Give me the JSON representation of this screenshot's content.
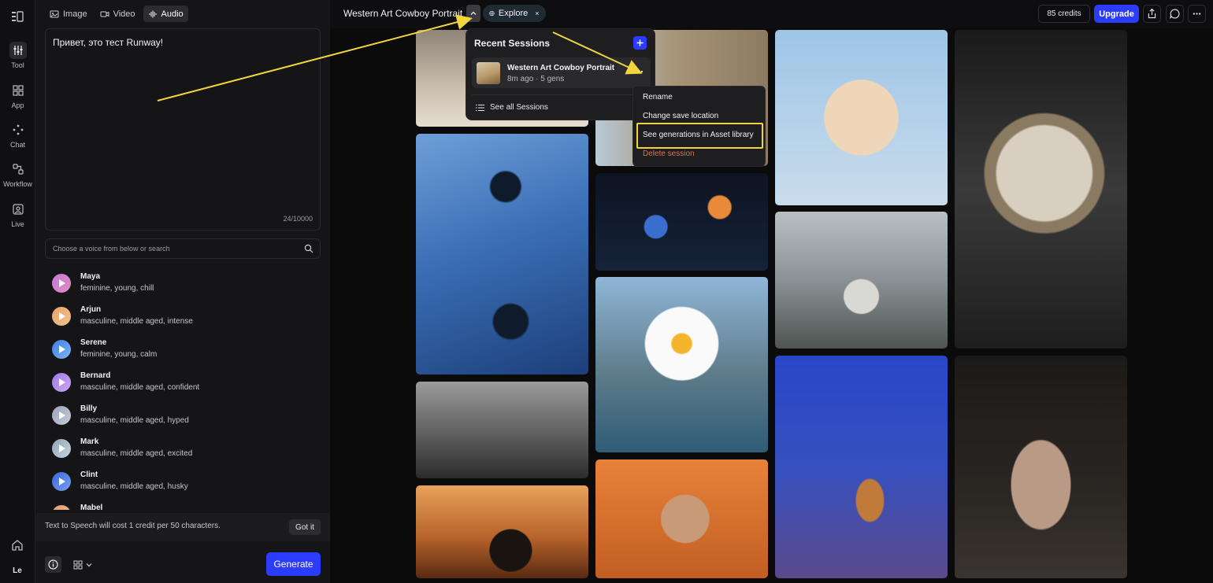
{
  "rail": {
    "items": [
      {
        "label": "Tool",
        "icon": "sliders-icon"
      },
      {
        "label": "App",
        "icon": "grid-icon"
      },
      {
        "label": "Chat",
        "icon": "sparkle-icon"
      },
      {
        "label": "Workflow",
        "icon": "workflow-icon"
      },
      {
        "label": "Live",
        "icon": "live-icon"
      }
    ],
    "avatar": "Le"
  },
  "modes": [
    {
      "label": "Image",
      "active": false
    },
    {
      "label": "Video",
      "active": false
    },
    {
      "label": "Audio",
      "active": true
    }
  ],
  "prompt": {
    "text": "Привет, это тест Runway!",
    "count": "24/10000"
  },
  "voice_search": {
    "placeholder": "Choose a voice from below or search"
  },
  "voices": [
    {
      "name": "Maya",
      "desc": "feminine, young, chill",
      "color": "#c07ad6"
    },
    {
      "name": "Arjun",
      "desc": "masculine, middle aged, intense",
      "color": "#e8a36a"
    },
    {
      "name": "Serene",
      "desc": "feminine, young, calm",
      "color": "#4f8fe8"
    },
    {
      "name": "Bernard",
      "desc": "masculine, middle aged, confident",
      "color": "#b58ae6"
    },
    {
      "name": "Billy",
      "desc": "masculine, middle aged, hyped",
      "color": "#a9b3c8"
    },
    {
      "name": "Mark",
      "desc": "masculine, middle aged, excited",
      "color": "#9fb4c3"
    },
    {
      "name": "Clint",
      "desc": "masculine, middle aged, husky",
      "color": "#4d7fe0"
    },
    {
      "name": "Mabel",
      "desc": "",
      "color": "#e6a680"
    }
  ],
  "notice": {
    "text": "Text to Speech will cost 1 credit per 50 characters.",
    "button": "Got it"
  },
  "generate_label": "Generate",
  "topbar": {
    "session_title": "Western Art Cowboy Portrait",
    "explore_label": "Explore",
    "credits": "85 credits",
    "upgrade_label": "Upgrade"
  },
  "sessions": {
    "title": "Recent Sessions",
    "item": {
      "name": "Western Art Cowboy Portrait",
      "meta": "8m ago · 5 gens"
    },
    "see_all": "See all Sessions"
  },
  "menu": {
    "rename": "Rename",
    "change_location": "Change save location",
    "see_generations": "See generations in Asset library",
    "delete": "Delete session"
  },
  "accent": "#2c3cff",
  "highlight": "#f2d53c"
}
